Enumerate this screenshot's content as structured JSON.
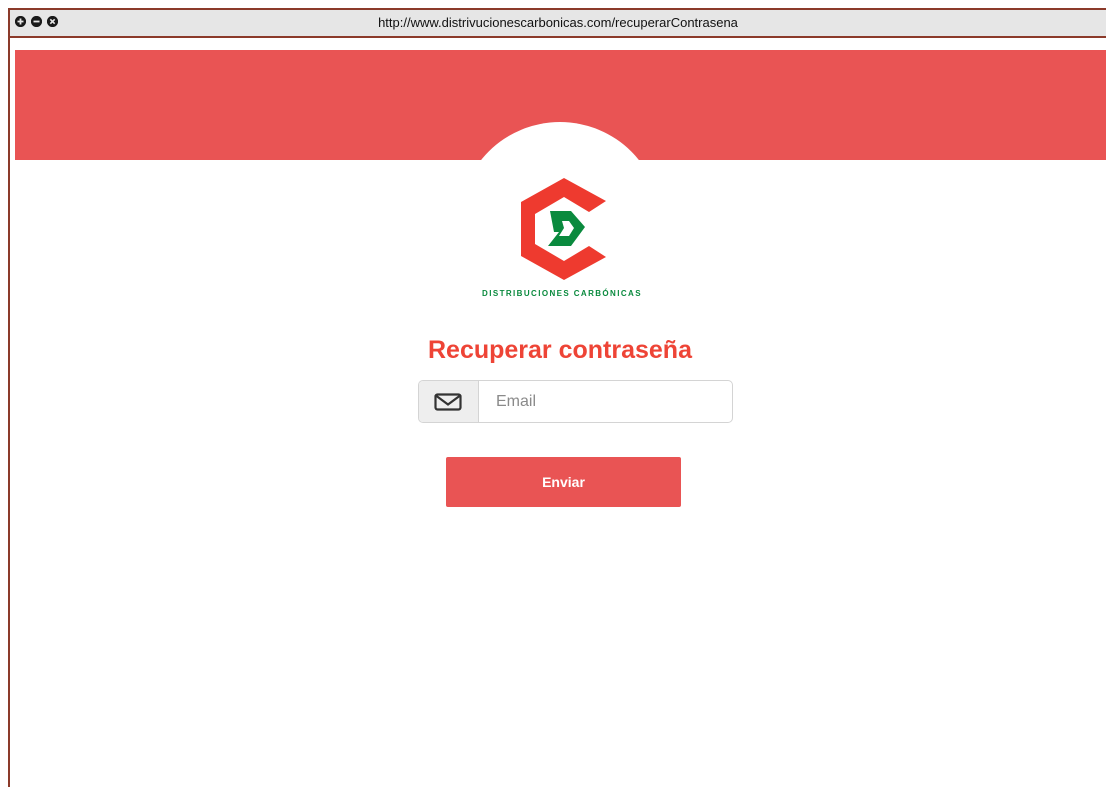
{
  "browser": {
    "url": "http://www.distrivucionescarbonicas.com/recuperarContrasena",
    "controls": [
      "maximize-icon",
      "minimize-icon",
      "close-icon"
    ]
  },
  "brand": {
    "company_name": "DISTRIBUCIONES CARBÓNICAS",
    "logo_icon": "cd-hexagon-logo",
    "colors": {
      "primary_red": "#e95454",
      "heading_red": "#ee4436",
      "green": "#0a8a3e"
    }
  },
  "form": {
    "title": "Recuperar contraseña",
    "email": {
      "icon": "envelope-icon",
      "placeholder": "Email",
      "value": ""
    },
    "submit_label": "Enviar"
  }
}
